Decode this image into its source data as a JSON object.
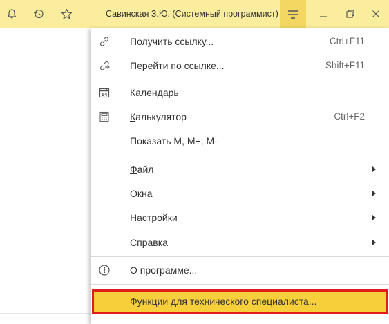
{
  "titlebar": {
    "user": "Савинская З.Ю. (Системный программист)",
    "icons": [
      "bell-icon",
      "history-icon",
      "star-icon",
      "menu-icon",
      "minimize-icon",
      "restore-icon",
      "close-icon"
    ]
  },
  "menu": {
    "items": [
      {
        "label": "Получить ссылку...",
        "shortcut": "Ctrl+F11",
        "icon": "link-icon"
      },
      {
        "label": "Перейти по ссылке...",
        "shortcut": "Shift+F11",
        "icon": "goto-link-icon"
      },
      {
        "label": "Календарь",
        "icon": "calendar-icon",
        "calendar_day": "14"
      },
      {
        "label": "Калькулятор",
        "shortcut": "Ctrl+F2",
        "icon": "calculator-icon"
      },
      {
        "label": "Показать M, M+, M-"
      },
      {
        "label": "Файл",
        "submenu": true
      },
      {
        "label": "Окна",
        "submenu": true
      },
      {
        "label": "Настройки",
        "submenu": true
      },
      {
        "label": "Справка",
        "submenu": true
      },
      {
        "label": "О программе...",
        "icon": "info-icon"
      },
      {
        "label": "Функции для технического специалиста..."
      }
    ]
  },
  "colors": {
    "titlebar": "#fbed9e",
    "menu_button_active": "#f3d762",
    "highlight": "#f6cf3b",
    "highlight_border": "#e21b1b"
  }
}
